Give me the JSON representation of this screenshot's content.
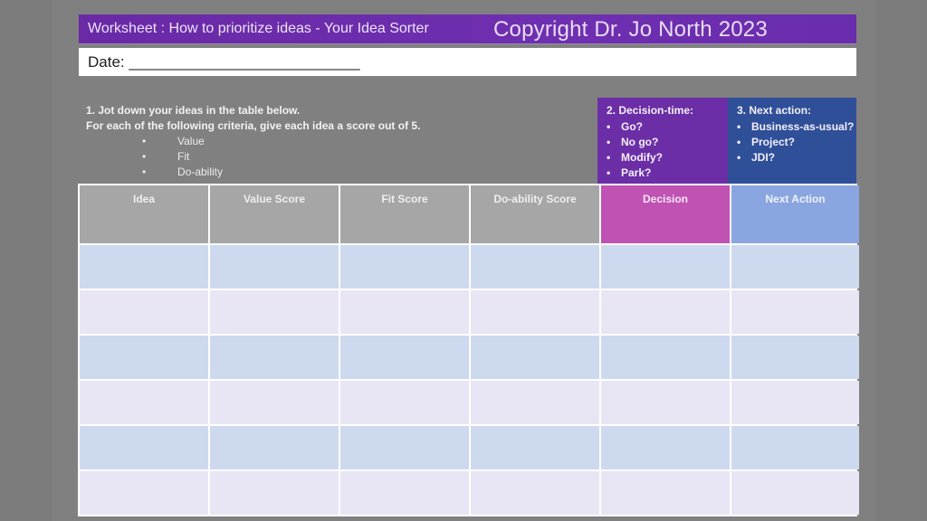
{
  "header": {
    "title": "Worksheet : How to prioritize ideas - Your Idea Sorter",
    "copyright": "Copyright Dr. Jo North 2023"
  },
  "date": {
    "label": "Date: ___________________________"
  },
  "instructions": {
    "step1": "1. Jot down your ideas in the table below.",
    "step1_detail": "For each of the following criteria, give each idea a score out of 5.",
    "criteria": [
      "Value",
      "Fit",
      "Do-ability"
    ],
    "bullet": "•"
  },
  "decision_box": {
    "title": "2. Decision-time:",
    "items": [
      "Go?",
      "No go?",
      "Modify?",
      "Park?"
    ],
    "color": "#6b2ea6"
  },
  "next_action_box": {
    "title": "3. Next action:",
    "items": [
      "Business-as-usual?",
      "Project?",
      "JDI?"
    ],
    "color": "#2f4f98"
  },
  "table": {
    "columns": [
      "Idea",
      "Value Score",
      "Fit Score",
      "Do-ability Score",
      "Decision",
      "Next Action"
    ],
    "header_colors": [
      "#a6a6a6",
      "#a6a6a6",
      "#a6a6a6",
      "#a6a6a6",
      "#c052b4",
      "#8aa6e0"
    ],
    "rows": [
      [
        "",
        "",
        "",
        "",
        "",
        ""
      ],
      [
        "",
        "",
        "",
        "",
        "",
        ""
      ],
      [
        "",
        "",
        "",
        "",
        "",
        ""
      ],
      [
        "",
        "",
        "",
        "",
        "",
        ""
      ],
      [
        "",
        "",
        "",
        "",
        "",
        ""
      ],
      [
        "",
        "",
        "",
        "",
        "",
        ""
      ]
    ],
    "row_colors": [
      "#cdd9ee",
      "#e8e6f4"
    ]
  }
}
